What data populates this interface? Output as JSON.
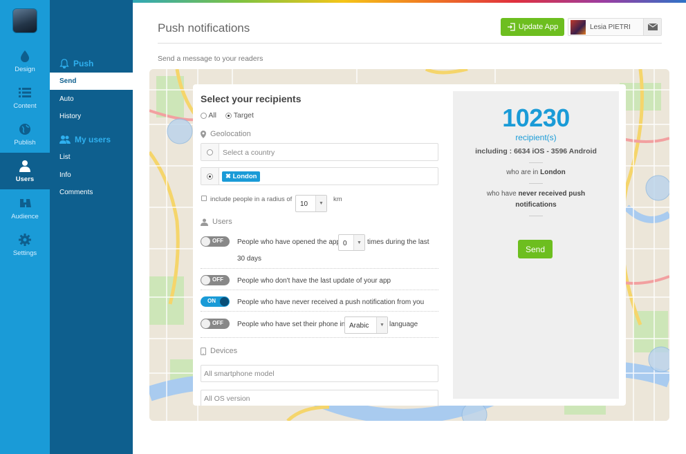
{
  "colors": {
    "brand": "#1a9bd7",
    "nav_dark": "#0e5f8e",
    "accent_green": "#6dbe1f"
  },
  "rail": {
    "items": [
      {
        "label": "Design",
        "icon": "droplet-icon"
      },
      {
        "label": "Content",
        "icon": "list-icon"
      },
      {
        "label": "Publish",
        "icon": "globe-icon"
      },
      {
        "label": "Users",
        "icon": "user-icon",
        "active": true
      },
      {
        "label": "Audience",
        "icon": "binoculars-icon"
      },
      {
        "label": "Settings",
        "icon": "gear-icon"
      }
    ]
  },
  "subnav": {
    "push_heading": "Push",
    "push_items": [
      "Send",
      "Auto",
      "History"
    ],
    "users_heading": "My users",
    "users_items": [
      "List",
      "Info",
      "Comments"
    ]
  },
  "header": {
    "title": "Push notifications",
    "subtitle": "Send a message to your readers",
    "update_label": "Update App",
    "user_name": "Lesia PIETRI"
  },
  "form": {
    "title": "Select your recipients",
    "opt_all": "All",
    "opt_target": "Target",
    "geo_label": "Geolocation",
    "country_placeholder": "Select a country",
    "city_tag": "London",
    "radius_label": "include people in a radius of",
    "radius_value": "10",
    "radius_unit": "km",
    "users_label": "Users",
    "rows": [
      {
        "state": "OFF",
        "text_before": "People who have opened the app",
        "select": "0",
        "text_after": "times during the last",
        "line2": "30 days"
      },
      {
        "state": "OFF",
        "text": "People who don't have the last update of your app"
      },
      {
        "state": "ON",
        "text": "People who have never received a push notification from you"
      },
      {
        "state": "OFF",
        "text_before": "People who have set their phone in",
        "select": "Arabic",
        "text_after": "language"
      }
    ],
    "devices_label": "Devices",
    "model_placeholder": "All smartphone model",
    "os_placeholder": "All OS version"
  },
  "summary": {
    "count": "10230",
    "count_label": "recipient(s)",
    "breakdown": "including : 6634 iOS - 3596 Android",
    "crit1_prefix": "who are in",
    "crit1_value": "London",
    "crit2_prefix": "who have",
    "crit2_value": "never received push notifications",
    "send_label": "Send"
  }
}
